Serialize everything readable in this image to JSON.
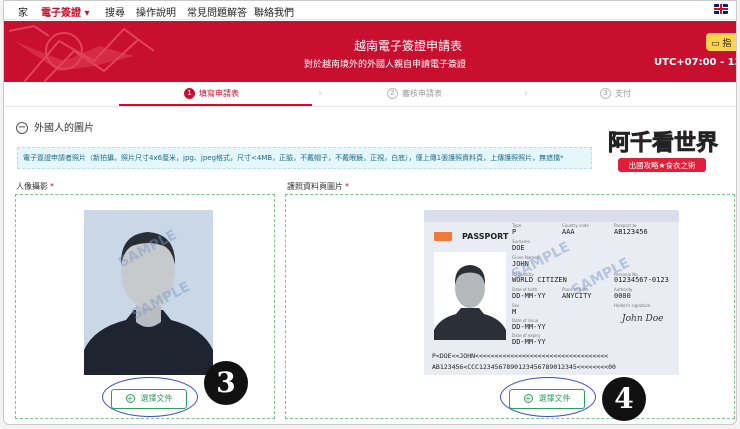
{
  "nav": {
    "items": [
      "家",
      "電子簽證",
      "搜尋",
      "操作說明",
      "常見問題解答",
      "聯絡我們"
    ],
    "active_index": 1,
    "dropdown_caret": "▾"
  },
  "banner": {
    "title": "越南電子簽證申請表",
    "subtitle": "對於越南境外的外國人親自申請電子簽證",
    "guide_label": "指",
    "utc_text": "UTC+07:00 - 13/11,"
  },
  "steps": [
    {
      "num": "1",
      "label": "填寫申請表",
      "active": true
    },
    {
      "num": "2",
      "label": "審核申請表",
      "active": false
    },
    {
      "num": "3",
      "label": "支付",
      "active": false
    }
  ],
  "section": {
    "toggle": "−",
    "title": "外國人的圖片"
  },
  "logo": {
    "main_text": "阿千看世界",
    "tagline": "出國攻略★食衣之術"
  },
  "note": "電子簽證申請者照片（新拍攝，照片尺寸4x6厘米，jpg、jpeg格式，尺寸<4MB，正臉，不戴帽子，不戴眼鏡，正視，白底），僅上傳1張護照資料頁，上傳護照照片，無遮擋*",
  "portrait": {
    "label": "人像攝影",
    "required_mark": "*",
    "watermark": "SAMPLE",
    "button_label": "選擇文件",
    "marker": "3"
  },
  "passport": {
    "label": "護照資料頁圖片",
    "required_mark": "*",
    "header": "PASSPORT",
    "fields": {
      "type_label": "Type",
      "type": "P",
      "country_label": "Country code",
      "country": "AAA",
      "passport_label": "Passport №",
      "passport": "AB123456",
      "surname_label": "Surname",
      "surname": "DOE",
      "given_label": "Given Names",
      "given": "JOHN",
      "nationality_label": "Nationality",
      "nationality": "WORLD CITIZEN",
      "personal_label": "Personal No.",
      "personal": "01234567-0123",
      "dob_label": "Date of birth",
      "dob": "DD-MM-YY",
      "pob_label": "Place of birth",
      "pob": "ANYCITY",
      "authority_label": "Authority",
      "authority": "0000",
      "sex_label": "Sex",
      "sex": "M",
      "signature_label": "Holder's signature",
      "doi_label": "Date of issue",
      "doi": "DD-MM-YY",
      "doe_label": "Date of expiry",
      "doe": "DD-MM-YY"
    },
    "mrz1": "P<DOE<<JOHN<<<<<<<<<<<<<<<<<<<<<<<<<<<<<<<<<<",
    "mrz2": "AB123456<CCC1234567890123456789012345<<<<<<<<00",
    "watermark": "SAMPLE",
    "button_label": "選擇文件",
    "marker": "4"
  },
  "colors": {
    "brand_red": "#c8102e",
    "upload_green": "#2e9e5e",
    "annotation_blue": "#3a4ccf"
  }
}
